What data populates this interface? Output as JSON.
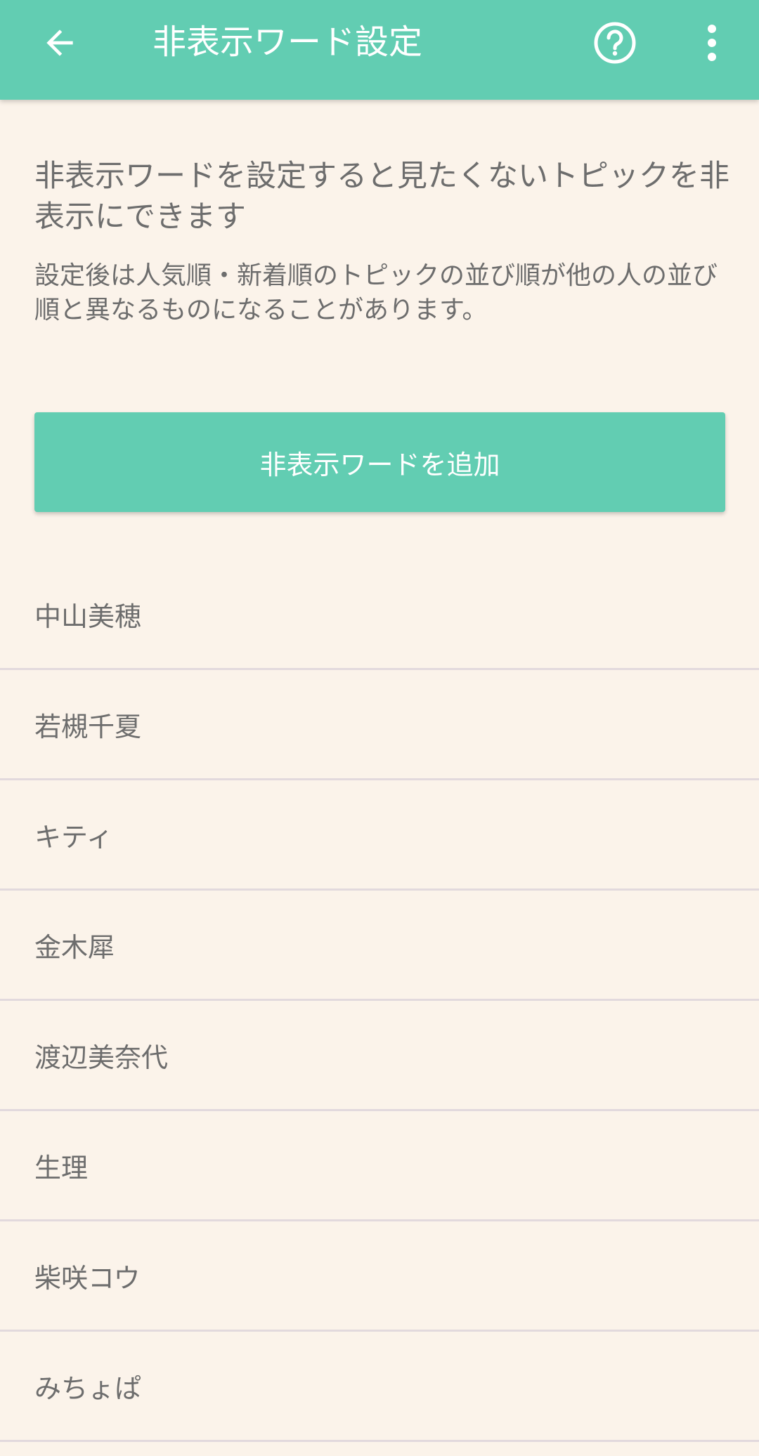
{
  "header": {
    "title": "非表示ワード設定",
    "back_icon": "arrow-left-icon",
    "help_icon": "help-circle-icon",
    "more_icon": "more-vertical-icon"
  },
  "intro": {
    "heading": "非表示ワードを設定すると見たくないトピックを非表示にできます",
    "note": "設定後は人気順・新着順のトピックの並び順が他の人の並び順と異なるものになることがあります。"
  },
  "add_button": {
    "label": "非表示ワードを追加"
  },
  "words": [
    "中山美穂",
    "若槻千夏",
    "キティ",
    "金木犀",
    "渡辺美奈代",
    "生理",
    "柴咲コウ",
    "みちょぱ"
  ],
  "colors": {
    "accent": "#62cdb2",
    "background": "#fbf3ea",
    "text": "#6d6d6d",
    "divider": "#e2d9dd"
  }
}
